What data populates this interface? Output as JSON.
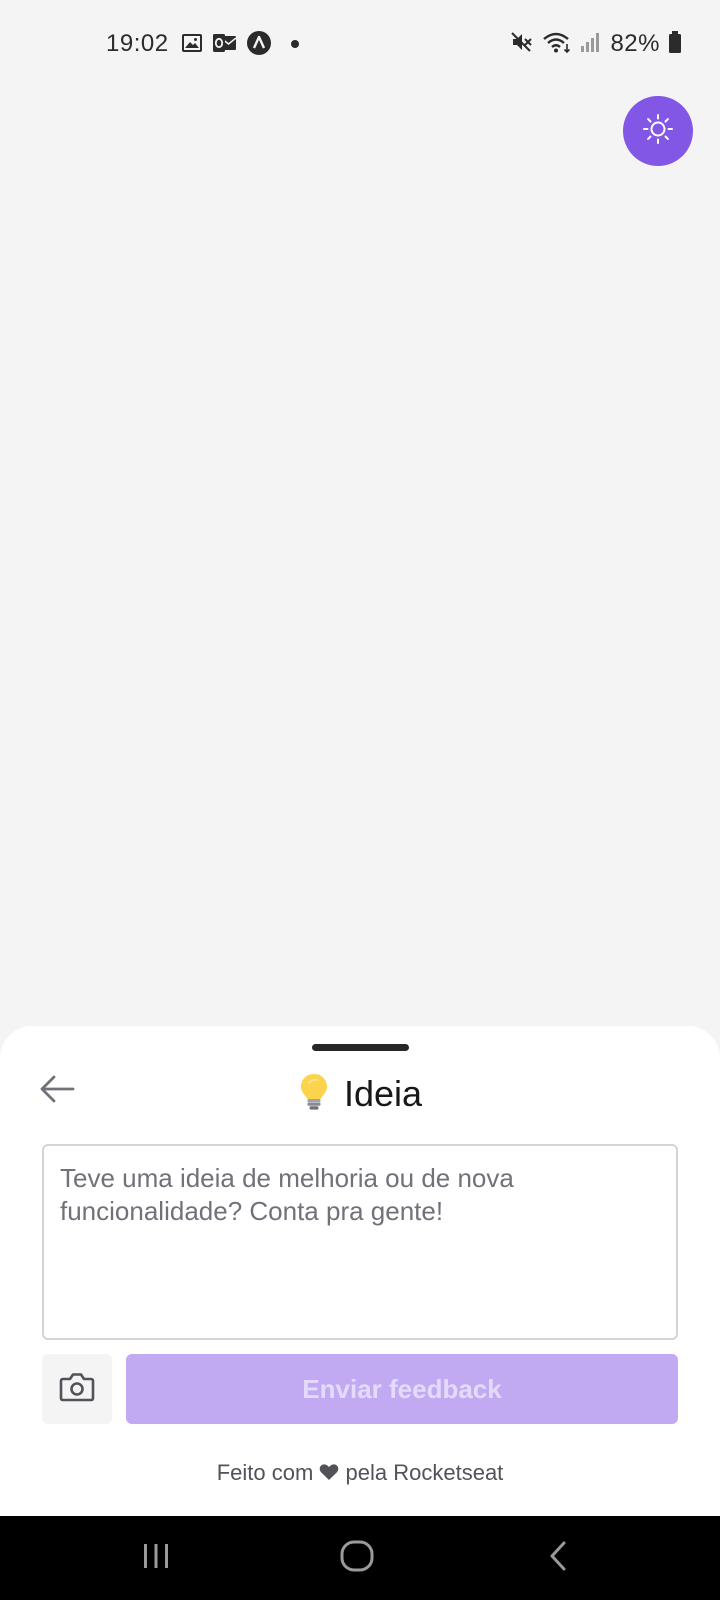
{
  "status_bar": {
    "time": "19:02",
    "battery_percent": "82%",
    "icons_left": [
      "image-icon",
      "outlook-icon",
      "app-icon",
      "dot-icon"
    ],
    "icons_right": [
      "mute-icon",
      "wifi-icon",
      "signal-icon",
      "battery-icon"
    ]
  },
  "theme_toggle": {
    "icon": "sun-icon",
    "color": "#8257e5"
  },
  "sheet": {
    "title": "Ideia",
    "title_emoji": "💡",
    "textarea": {
      "placeholder": "Teve uma ideia de melhoria ou de nova funcionalidade? Conta pra gente!",
      "value": ""
    },
    "submit_label": "Enviar feedback",
    "footer": {
      "prefix": "Feito com",
      "suffix": "pela Rocketseat"
    }
  },
  "colors": {
    "brand": "#8257e5",
    "button_disabled": "#c2aaf3",
    "background": "#f4f4f5",
    "sheet": "#ffffff"
  }
}
